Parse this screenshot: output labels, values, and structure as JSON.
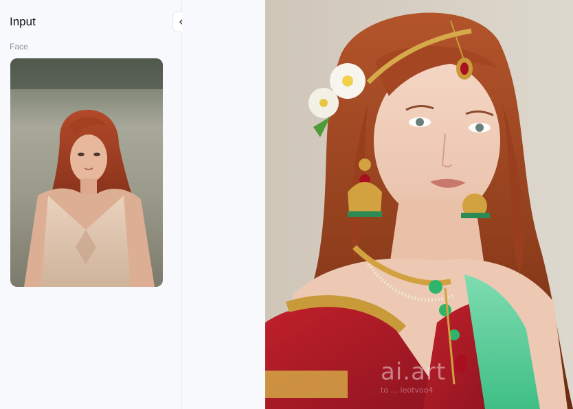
{
  "panel": {
    "title": "Input",
    "face_label": "Face"
  },
  "collapse_button": {
    "icon": "double-chevron-left-icon"
  },
  "result": {
    "watermark": "ai.art",
    "watermark_sub": "to ... ieotvoo4"
  },
  "colors": {
    "panel_bg": "#f8f9fc",
    "border": "#e6e8ef",
    "title_text": "#111111",
    "label_text": "#8a8f9c"
  }
}
